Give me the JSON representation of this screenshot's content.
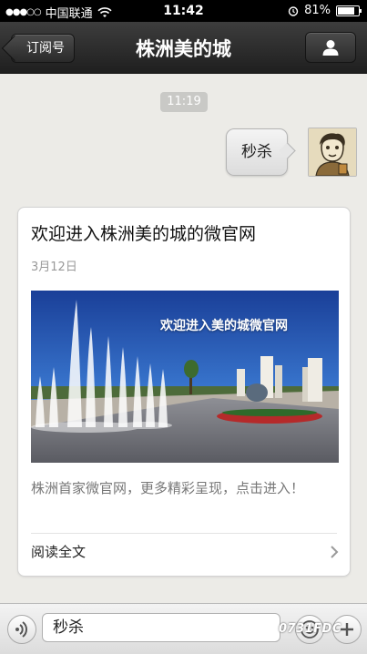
{
  "status_bar": {
    "carrier": "中国联通",
    "time": "11:42",
    "battery": "81%",
    "battery_level": 0.81
  },
  "nav": {
    "back_label": "订阅号",
    "title": "株洲美的城",
    "profile_icon": "person-icon"
  },
  "chat": {
    "timestamp": "11:19",
    "sent_message": "秒杀"
  },
  "article": {
    "title": "欢迎进入株洲美的城的微官网",
    "date": "3月12日",
    "image_caption": "欢迎进入美的城微官网",
    "description": "株洲首家微官网，更多精彩呈现，点击进入！",
    "read_more": "阅读全文"
  },
  "input_bar": {
    "text": "秒杀",
    "watermark": "0731FDC"
  },
  "colors": {
    "nav_bg": "#2a2a2a",
    "chat_bg": "#ecebe7",
    "sky": "#1f4fa8"
  }
}
